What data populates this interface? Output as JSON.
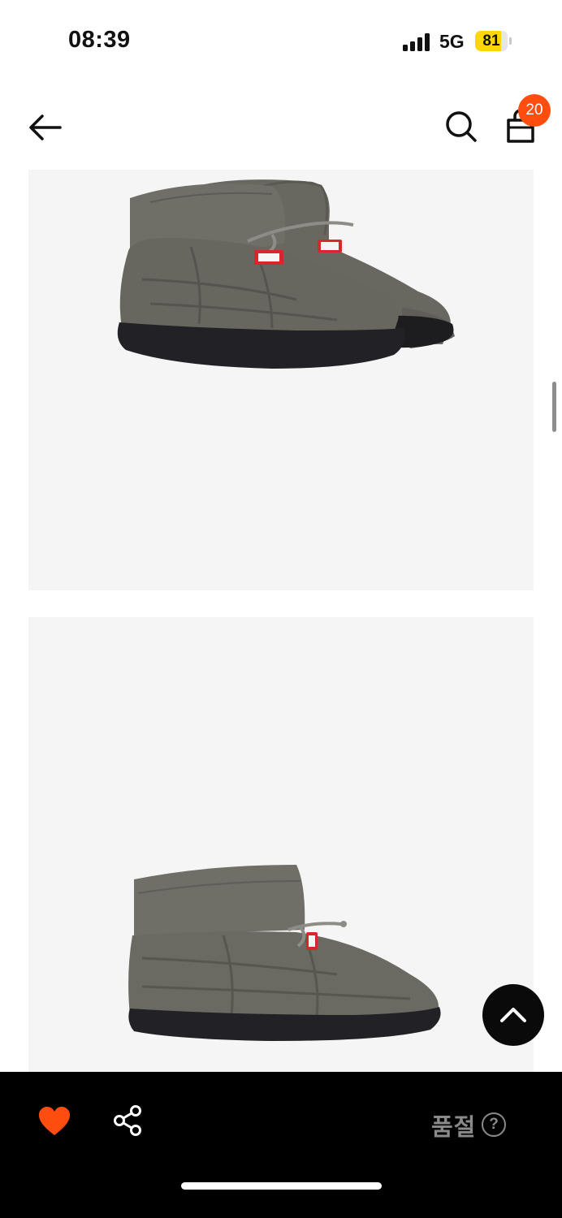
{
  "status_bar": {
    "time": "08:39",
    "network": "5G",
    "battery_level": "81",
    "battery_fraction": 0.81,
    "battery_color": "#ffd60a"
  },
  "header": {
    "back_icon": "arrow-left-icon",
    "search_icon": "search-icon",
    "cart_icon": "shopping-bag-icon",
    "cart_count": "20",
    "badge_color": "#ff4d0f"
  },
  "gallery": {
    "images": [
      {
        "description_icon": "quilted-grey-boots-pair"
      },
      {
        "description_icon": "quilted-grey-boot-side"
      }
    ]
  },
  "floating": {
    "scroll_top_icon": "chevron-up-icon"
  },
  "bottom_bar": {
    "like_icon": "heart-icon",
    "like_color": "#ff4d0f",
    "share_icon": "share-icon",
    "status_label": "품절",
    "help_symbol": "?"
  }
}
